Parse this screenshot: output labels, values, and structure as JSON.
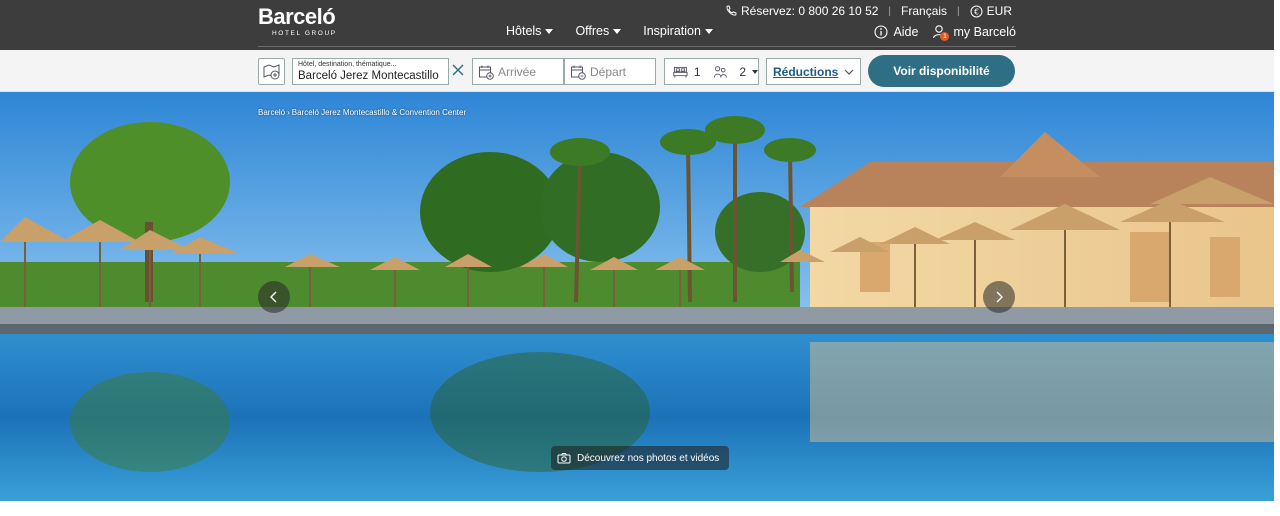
{
  "brand": {
    "name": "Barceló",
    "subtitle": "HOTEL GROUP"
  },
  "topbar": {
    "phone_label": "Réservez: 0 800 26 10 52",
    "language": "Français",
    "currency": "EUR"
  },
  "nav": {
    "items": [
      {
        "label": "Hôtels"
      },
      {
        "label": "Offres"
      },
      {
        "label": "Inspiration"
      }
    ]
  },
  "user": {
    "help_label": "Aide",
    "account_label": "my Barceló",
    "badge": "1"
  },
  "search": {
    "destination_label": "Hôtel, destination, thématique...",
    "destination_value": "Barceló Jerez Montecastillo",
    "checkin_placeholder": "Arrivée",
    "checkout_placeholder": "Départ",
    "rooms": "1",
    "guests": "2",
    "promo_label": "Réductions",
    "cta_label": "Voir disponibilité"
  },
  "breadcrumb": {
    "home": "Barceló",
    "separator": "›",
    "current": "Barceló Jerez Montecastillo & Convention Center"
  },
  "hero": {
    "media_label": "Découvrez nos photos et vidéos"
  },
  "colors": {
    "header_bg": "#3d3d3d",
    "cta_bg": "#2f6f86",
    "promo_text": "#1d5d82"
  },
  "icons": [
    "phone-icon",
    "globe-currency-icon",
    "info-icon",
    "user-icon",
    "map-pin-icon",
    "close-icon",
    "calendar-icon",
    "bed-icon",
    "people-icon",
    "chevron-down-icon",
    "chevron-left-icon",
    "chevron-right-icon",
    "camera-icon"
  ]
}
